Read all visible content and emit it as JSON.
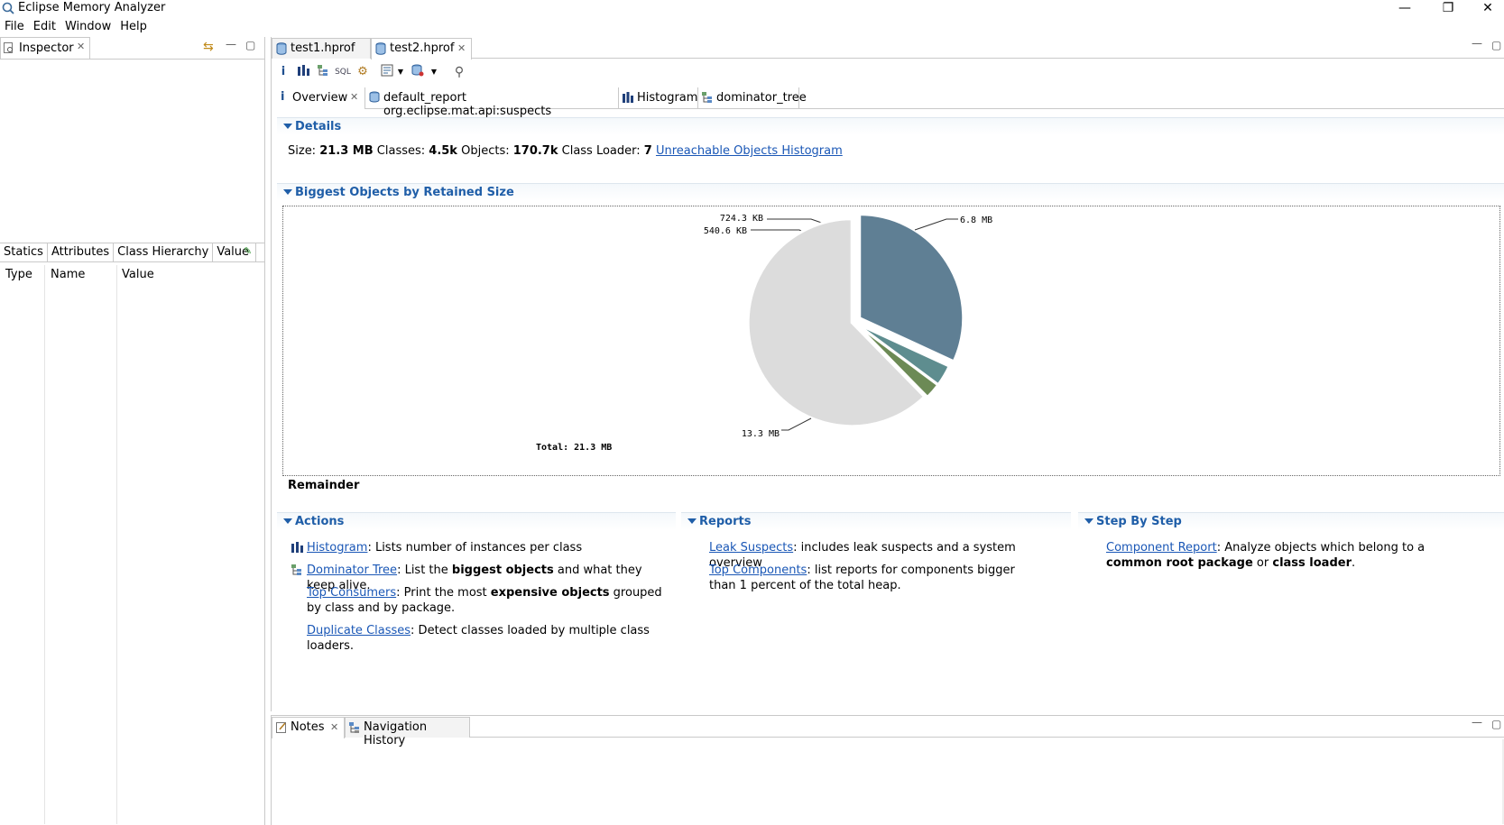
{
  "window": {
    "title": "Eclipse Memory Analyzer",
    "minimize": "—",
    "restore": "❐",
    "close": "✕"
  },
  "menu": [
    "File",
    "Edit",
    "Window",
    "Help"
  ],
  "inspector": {
    "tab_label": "Inspector",
    "subtabs": [
      "Statics",
      "Attributes",
      "Class Hierarchy",
      "Value"
    ],
    "columns": [
      "Type",
      "Name",
      "Value"
    ]
  },
  "editor": {
    "tabs": [
      "test1.hprof",
      "test2.hprof"
    ],
    "subtabs": [
      "Overview",
      "default_report  org.eclipse.mat.api:suspects",
      "Histogram",
      "dominator_tree"
    ]
  },
  "details": {
    "header": "Details",
    "size_label": "Size: ",
    "size_value": "21.3 MB",
    "classes_label": " Classes: ",
    "classes_value": "4.5k",
    "objects_label": " Objects: ",
    "objects_value": "170.7k",
    "loader_label": " Class Loader: ",
    "loader_value": "7",
    "unreachable_link": "Unreachable Objects Histogram"
  },
  "biggest": {
    "header": "Biggest Objects by Retained Size",
    "total": "Total: 21.3 MB",
    "remainder": "Remainder"
  },
  "chart_data": {
    "type": "pie",
    "unit": "MB",
    "slices": [
      {
        "label": "6.8 MB",
        "value": 6.8,
        "color": "#5f7f94"
      },
      {
        "label": "724.3 KB",
        "value": 0.7073,
        "color": "#5e8d8f"
      },
      {
        "label": "540.6 KB",
        "value": 0.5279,
        "color": "#6c8a55"
      },
      {
        "label": "13.3 MB",
        "value": 13.3,
        "color": "#dcdcdc"
      }
    ],
    "total_label": "Total: 21.3 MB"
  },
  "actions": {
    "header": "Actions",
    "items": [
      {
        "link": "Histogram",
        "pre": ": Lists number of instances per class",
        "bold": "",
        "post": ""
      },
      {
        "link": "Dominator Tree",
        "pre": ": List the ",
        "bold": "biggest objects",
        "post": " and what they keep alive."
      },
      {
        "link": "Top Consumers",
        "pre": ": Print the most ",
        "bold": "expensive objects",
        "post": " grouped by class and by package."
      },
      {
        "link": "Duplicate Classes",
        "pre": ": Detect classes loaded by multiple class loaders.",
        "bold": "",
        "post": ""
      }
    ]
  },
  "reports": {
    "header": "Reports",
    "items": [
      {
        "link": "Leak Suspects",
        "text": ": includes leak suspects and a system overview"
      },
      {
        "link": "Top Components",
        "text": ": list reports for components bigger than 1 percent of the total heap."
      }
    ]
  },
  "stepbystep": {
    "header": "Step By Step",
    "link": "Component Report",
    "pre": ": Analyze objects which belong to a ",
    "bold1": "common root package",
    "mid": " or ",
    "bold2": "class loader",
    "post": "."
  },
  "bottom": {
    "tabs": [
      "Notes",
      "Navigation History"
    ]
  }
}
